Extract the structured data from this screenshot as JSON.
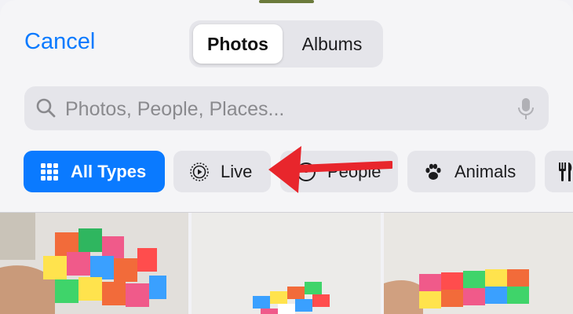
{
  "header": {
    "cancel_label": "Cancel",
    "segments": [
      {
        "label": "Photos",
        "selected": true
      },
      {
        "label": "Albums",
        "selected": false
      }
    ]
  },
  "search": {
    "placeholder": "Photos, People, Places..."
  },
  "filters": [
    {
      "label": "All Types",
      "icon": "grid-icon",
      "selected": true
    },
    {
      "label": "Live",
      "icon": "live-photo-icon",
      "selected": false
    },
    {
      "label": "People",
      "icon": "person-icon",
      "selected": false
    },
    {
      "label": "Animals",
      "icon": "paw-icon",
      "selected": false
    },
    {
      "label": "",
      "icon": "fork-knife-icon",
      "selected": false
    }
  ],
  "colors": {
    "accent": "#0a7aff",
    "annotation_arrow": "#e8262c"
  },
  "photos": [
    {
      "subject": "rubiks-cube-hand"
    },
    {
      "subject": "rubiks-cube-table"
    },
    {
      "subject": "rubiks-cube-colorful"
    }
  ]
}
